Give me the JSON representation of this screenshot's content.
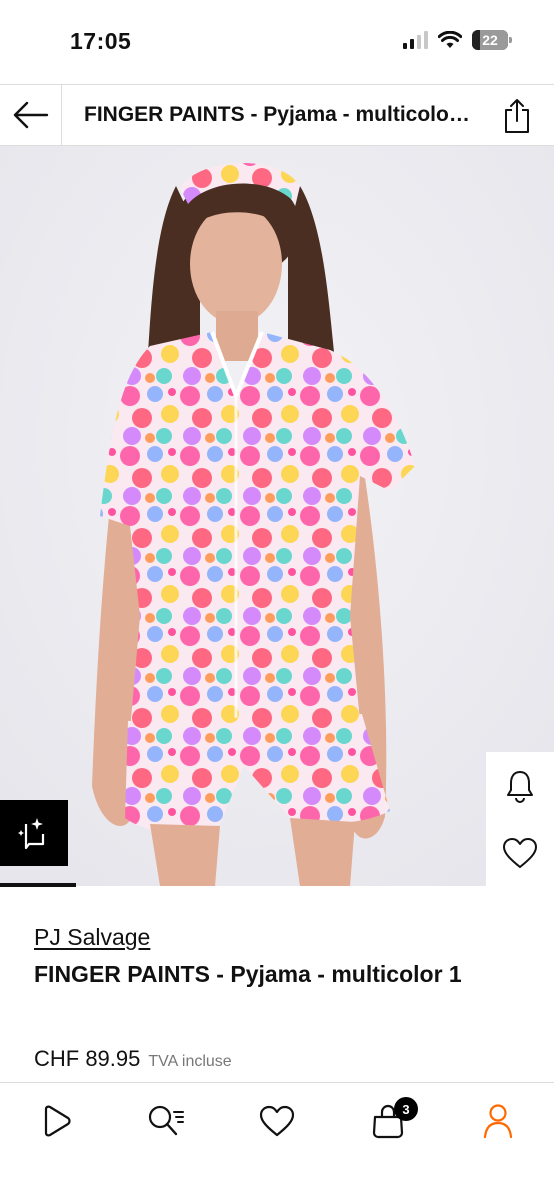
{
  "status_bar": {
    "time": "17:05",
    "battery": "22",
    "battery_level": 0.22,
    "icons": [
      "signal-icon",
      "wifi-icon",
      "battery-icon"
    ]
  },
  "header": {
    "title": "FINGER PAINTS - Pyjama - multicolor 1",
    "back_icon": "arrow-left-icon",
    "share_icon": "share-icon"
  },
  "image": {
    "side_actions": [
      "bell-icon",
      "heart-icon"
    ],
    "similar_icon": "similar-items-icon",
    "active_slide": 1
  },
  "product": {
    "brand": "PJ Salvage",
    "name": "FINGER PAINTS - Pyjama - multicolor 1",
    "price": "CHF 89.95",
    "vat_note": "TVA incluse"
  },
  "tab_bar": {
    "items": [
      {
        "icon": "play-discover-icon"
      },
      {
        "icon": "search-filter-icon"
      },
      {
        "icon": "heart-icon"
      },
      {
        "icon": "bag-icon",
        "badge": "3"
      },
      {
        "icon": "profile-icon",
        "active": true
      }
    ],
    "colors": {
      "active": "#ff6900",
      "default": "#111111"
    }
  },
  "colors": {
    "accent": "#ff6900",
    "text": "#111111",
    "muted": "#777777"
  }
}
